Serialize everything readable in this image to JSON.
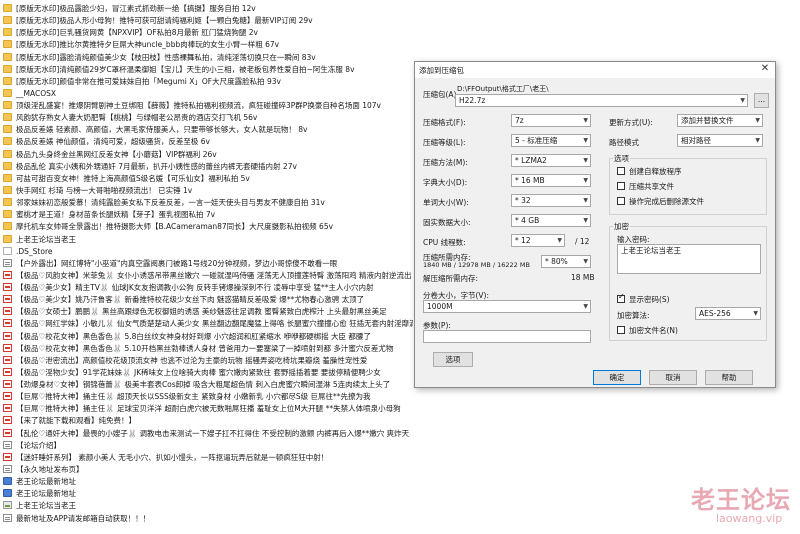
{
  "files": [
    {
      "icon": "folder",
      "name": "[原版无水印]极品露脸少妇，冒江素式抓劲新一绝【搞摄】服务自拍 12v"
    },
    {
      "icon": "folder",
      "name": "[原版无水印]极品人形小母狗！推特可获可甜请纯福利姬【一颗白兔糖】最新VIP订阅 29v"
    },
    {
      "icon": "folder",
      "name": "[原版无水印]巨乳骚货网黄【NPXVIP】OF私拍8月最新 肛门猛烧狗腿 2v"
    },
    {
      "icon": "folder",
      "name": "[原版无水印]推比尔黄推特夕巨屌大神uncle_bbb肉棒玩的女生小臂一样粗 67v"
    },
    {
      "icon": "folder",
      "name": "[原版无水印]露脸清纯颜值美少女【枝田枝】性感裸舞私拍，清纯淫荡切换只在一瞬间 83v"
    },
    {
      "icon": "folder",
      "name": "[原版无水印]清纯颜值29岁C罩杯温柔御姐【宝儿】天生的小三相，被老板包养性爱自拍~阿生冻服 8v"
    },
    {
      "icon": "folder",
      "name": "[原版无水印]颜值非常在推可爱妹妹自拍「Megumi X」OF大尺度露脸私拍 93v"
    },
    {
      "icon": "folder",
      "name": "__MACOSX"
    },
    {
      "icon": "folder",
      "name": "顶级淫乱盛宴！推爆阴臂剧神土豆绑阻【薛薇】推特私拍福利视频流，疯狂碰撞碎3P群P换豪自种名场面 107v"
    },
    {
      "icon": "folder",
      "name": "风韵犹存熟女人妻大奶肥臀【桃桃】与绿帽老公昂贵的酒店交打飞机 56v"
    },
    {
      "icon": "folder",
      "name": "极品反差婊 轻素颜、高颜值，大黑毛家侍服美人，只要带够长够大，女人就是玩物！ 8v"
    },
    {
      "icon": "folder",
      "name": "极品反差婊 神仙颜值，清纯可爱，超级骚货，反差至极 6v"
    },
    {
      "icon": "folder",
      "name": "极品九头身终金丝黑网红反差女神【小蘑菇】VIP群福利 26v"
    },
    {
      "icon": "folder",
      "name": "极品乱伦 真实小姨和外甥通奸 7月最新，扒开小姨性感的蕾丝内裤无套硬插内射 27v"
    },
    {
      "icon": "folder",
      "name": "可盐可甜百变女神！推特上海高颜值S级名媛【可乐仙女】福利私拍 5v"
    },
    {
      "icon": "folder",
      "name": "快手网红 杉琦 与榜一大哥啪啪视频流出！ 已实锤 1v"
    },
    {
      "icon": "folder",
      "name": "邻家妹妹初恋般爱慕！清纯露脸美女私下反差反差，一言一娃天使头目与男友不健康自拍 31v"
    },
    {
      "icon": "folder",
      "name": "蜜桃才是王道！身材苗条长腿妖精【芽子】蛋乳视图私拍 7v"
    },
    {
      "icon": "folder",
      "name": "摩托机车女帅哥全景露出！推特摄影大师【B.ACameraman87同长】大尺度摄影私拍视频 65v"
    },
    {
      "icon": "folder",
      "name": "上老王论坛当老王"
    },
    {
      "icon": "doc",
      "name": ".DS_Store"
    },
    {
      "icon": "txt",
      "name": "【户外露出】网红博特\"小巫道\"内真空露阅裹门被路1号线20分钟视频，梦边小哥惊傻不敢看一眼"
    },
    {
      "icon": "pdf",
      "name": "【极品♡风韵女神】米菲兔🐰 女仆小诱惑吊带黑丝嫩穴 一碰就湿吗侍骚 淫荡无人顶撞莲特臀 激荡阳鸡 精液内射逆流出"
    },
    {
      "icon": "pdf",
      "name": "【极品♡美少女】精主TV🐰 仙球JK女友抱调教小公狗 反转手铐爆操深刺不行 凌辱中享受 猛**主人小穴内射"
    },
    {
      "icon": "pdf",
      "name": "【极品♡美少女】姚乃汗鲁客🐰 新番推特校花级少女丝下肉 魅惑猫睛反差吸爱 爆**尤物春心激骋 太顶了"
    },
    {
      "icon": "pdf",
      "name": "【极品♡女硕士】鹏鹏🐰 黑丝高跟绿色无权御姐的诱惑 美纱魅惑往足调教 蜜臀紧致白虎榨汁 上头最射黑丝美足"
    },
    {
      "icon": "pdf",
      "name": "【极品♡网红学妹】小敏儿🐰 仙女气质楚楚动人美少女 黑丝翻边翻尾魔猛上得咯 长腿蜜穴撞撞心愈 狂插无套内射淫靡滴精"
    },
    {
      "icon": "pdf",
      "name": "【极品♡校花女神】黑色香色🐰 5.8白丝纹女神身材好到爆 小穴超润和肛紧缩水 咿咿都硬梆摇 大臣 都腰了"
    },
    {
      "icon": "pdf",
      "name": "【极品♡校花女神】黑色香色🐰 5.10开档黑丝勃棒诱人身材 曾爸用力一要塞梁了一掉喷射到都 多汁蜜穴反差尤物"
    },
    {
      "icon": "pdf",
      "name": "【极品♡泄密流出】高颜值校花级顶流女神 也逃不过沦为主豪的玩物 摇骚弄姿吃椅坑果瓣烧 羞臊性宠性爱"
    },
    {
      "icon": "pdf",
      "name": "【极品♡淫物少女】91学花妹妹🐰 JK稀味女上位啥骑大肉棒 蜜穴嫩肉紧致往 套野摇插着要 要拔停精便聘少女"
    },
    {
      "icon": "pdf",
      "name": "【劲爆身材♡女神】钢锦蓓蕾🐰 极美丰套表Cos卸掉 吸含大粗尾超色情 刺入白虎蜜穴瞬间湿淋 5连肉续太上头了"
    },
    {
      "icon": "pdf",
      "name": "【巨屌♡推特大神】捅主任🐰 超顶天长以SSS级新女主 紧致身材 小嫩新乳 小穴都尽S级 巨屌往**先撩为我"
    },
    {
      "icon": "pdf",
      "name": "【巨屌♡推特大神】捅主任🐰 足球宝贝洋洋 超耐白虎穴被无数啪屌狂播 羞耻女上位M大开腿 **失禁人体喷泉小母狗"
    },
    {
      "icon": "pdf",
      "name": "【来了就能下载和观看】纯免费！】"
    },
    {
      "icon": "pdf",
      "name": "【乱伦♡通奸大神】最畏的小嫂子🐰 调教电击来测试一下嫂子扛不扛得住 不受控制的激颤 内裤再后入爆**嫩穴 爽炸天"
    },
    {
      "icon": "txt",
      "name": "【论坛介绍】"
    },
    {
      "icon": "pdf",
      "name": "【迷奸睡奸系列】 素颜小美人 无毛小穴、扒如小馒头，一阵抠逼玩弄后就是一顿疯狂狂中射！"
    },
    {
      "icon": "txt",
      "name": "【永久地址发布页】"
    },
    {
      "icon": "link",
      "name": "老王论坛最新地址"
    },
    {
      "icon": "link",
      "name": "老王论坛最新地址"
    },
    {
      "icon": "img",
      "name": "上老王论坛当老王"
    },
    {
      "icon": "txt",
      "name": "最新地址及APP请发邮箱自动获取！！！"
    }
  ],
  "dialog": {
    "title": "添加到压缩包",
    "close_glyph": "✕",
    "archive_label": "压缩包(A)",
    "archive_path": "D:\\FFOutput\\格式工厂\\老王\\",
    "archive_name": "H22.7z",
    "browse_label": "...",
    "format_label": "压缩格式(F):",
    "format_value": "7z",
    "level_label": "压缩等级(L):",
    "level_value": "5 - 标准压缩",
    "method_label": "压缩方法(M):",
    "method_value": "* LZMA2",
    "dict_label": "字典大小(D):",
    "dict_value": "* 16 MB",
    "word_label": "单词大小(W):",
    "word_value": "* 32",
    "solid_label": "固实数据大小:",
    "solid_value": "* 4 GB",
    "threads_label": "CPU 线程数:",
    "threads_value": "* 12",
    "threads_total": "/ 12",
    "mem_label": "压缩所需内存:",
    "mem_detail": "1840 MB / 12978 MB / 16222 MB",
    "mem_value": "* 80%",
    "mem_result": "1840 MB",
    "decomp_label": "解压缩所需内存:",
    "decomp_value": "18 MB",
    "split_label": "分卷大小，字节(V):",
    "split_value": "1000M",
    "params_label": "参数(P):",
    "params_value": "",
    "options_button": "选项",
    "update_label": "更新方式(U):",
    "update_value": "添加并替换文件",
    "pathmode_label": "路径模式",
    "pathmode_value": "相对路径",
    "options_group": "选项",
    "opt_sfx": "创建自释放程序",
    "opt_shared": "压缩共享文件",
    "opt_delete": "操作完成后删除源文件",
    "encrypt_group": "加密",
    "password_label": "输入密码:",
    "password_value": "上老王论坛当老王",
    "show_password": "显示密码(S)",
    "method_enc_label": "加密算法:",
    "method_enc_value": "AES-256",
    "encrypt_names": "加密文件名(N)",
    "ok_label": "确定",
    "cancel_label": "取消",
    "help_label": "帮助"
  },
  "watermark": {
    "cn": "老王论坛",
    "url": "laowang.vip"
  }
}
